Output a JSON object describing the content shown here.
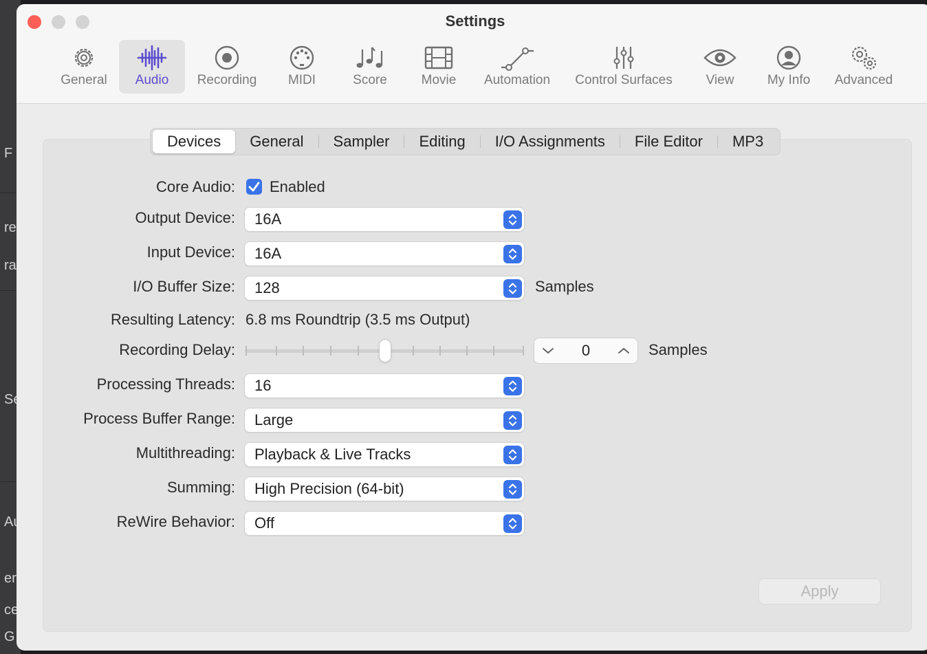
{
  "window": {
    "title": "Settings"
  },
  "background_fragments": [
    "F",
    "re",
    "ra",
    "Se",
    "Au",
    "er",
    "ce",
    "G"
  ],
  "toolbar": {
    "items": [
      {
        "label": "General",
        "icon": "gear-icon"
      },
      {
        "label": "Audio",
        "icon": "waveform-icon",
        "active": true
      },
      {
        "label": "Recording",
        "icon": "record-icon"
      },
      {
        "label": "MIDI",
        "icon": "midi-connector-icon"
      },
      {
        "label": "Score",
        "icon": "music-notes-icon"
      },
      {
        "label": "Movie",
        "icon": "film-icon"
      },
      {
        "label": "Automation",
        "icon": "automation-curve-icon"
      },
      {
        "label": "Control Surfaces",
        "icon": "sliders-icon"
      },
      {
        "label": "View",
        "icon": "eye-icon"
      },
      {
        "label": "My Info",
        "icon": "person-circle-icon"
      },
      {
        "label": "Advanced",
        "icon": "gears-icon"
      }
    ]
  },
  "tabs": [
    "Devices",
    "General",
    "Sampler",
    "Editing",
    "I/O Assignments",
    "File Editor",
    "MP3"
  ],
  "selected_tab": "Devices",
  "form": {
    "core_audio_label": "Core Audio:",
    "core_audio_checkbox": "Enabled",
    "core_audio_checked": true,
    "output_device_label": "Output Device:",
    "output_device_value": "16A",
    "input_device_label": "Input Device:",
    "input_device_value": "16A",
    "buffer_size_label": "I/O Buffer Size:",
    "buffer_size_value": "128",
    "buffer_size_unit": "Samples",
    "latency_label": "Resulting Latency:",
    "latency_value": "6.8 ms Roundtrip (3.5 ms Output)",
    "recording_delay_label": "Recording Delay:",
    "recording_delay_value": "0",
    "recording_delay_unit": "Samples",
    "recording_delay_slider_level": 0.5,
    "threads_label": "Processing Threads:",
    "threads_value": "16",
    "buffer_range_label": "Process Buffer Range:",
    "buffer_range_value": "Large",
    "multithreading_label": "Multithreading:",
    "multithreading_value": "Playback & Live Tracks",
    "summing_label": "Summing:",
    "summing_value": "High Precision (64-bit)",
    "rewire_label": "ReWire Behavior:",
    "rewire_value": "Off"
  },
  "apply_label": "Apply",
  "colors": {
    "accent": "#3a73e8",
    "active_icon": "#5b4ccf",
    "close": "#ff5f57"
  }
}
